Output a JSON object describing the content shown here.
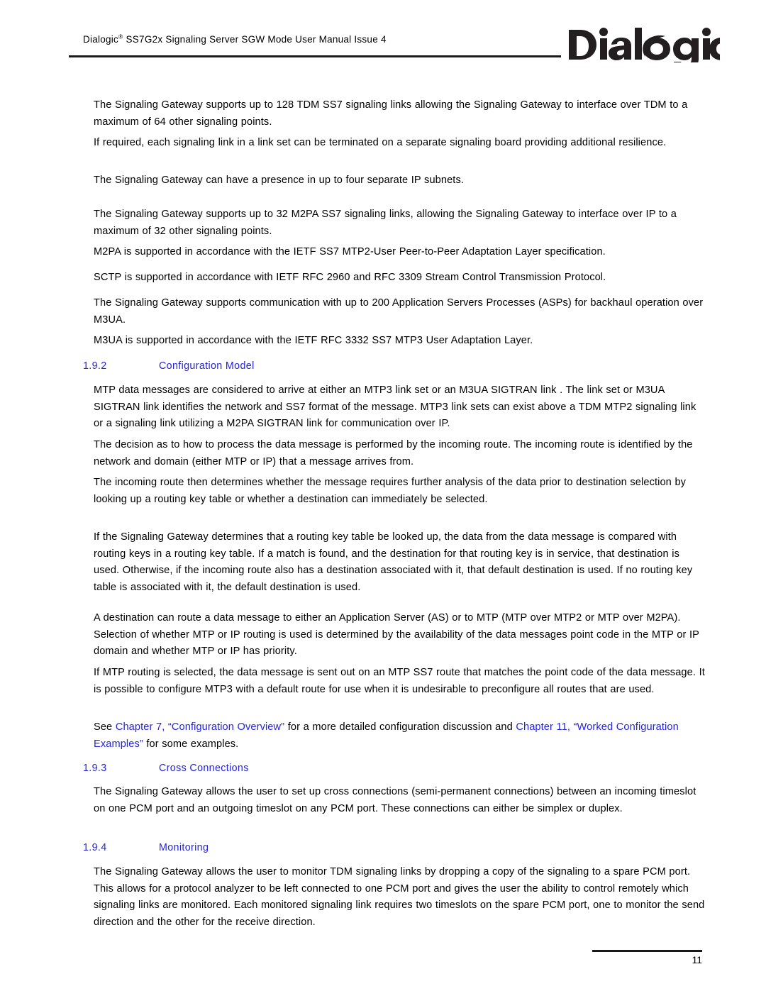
{
  "document": {
    "header_title_prefix": "Dialogic",
    "header_title_mark": "®",
    "header_title_rest": " SS7G2x Signaling Server SGW Mode User Manual  Issue 4",
    "logo_text": "Dialogic",
    "logo_mark": "®",
    "page_number": "11",
    "accent_blue": "#2323E0",
    "rule_color": "#1a1a1a"
  },
  "body": {
    "p1": "The Signaling Gateway supports up to 128 TDM SS7 signaling links allowing the Signaling Gateway to interface over TDM to a maximum of 64 other signaling points.",
    "p2": "If required, each signaling link in a link set can be terminated on a separate signaling board providing additional resilience.",
    "p3": "The Signaling Gateway can have a presence in up to four separate IP subnets.",
    "p4": "The Signaling Gateway supports up to 32 M2PA SS7 signaling links, allowing the Signaling Gateway to interface over IP to a maximum of 32 other signaling points.",
    "p5": "M2PA is supported in accordance with the IETF SS7 MTP2-User Peer-to-Peer Adaptation Layer specification.",
    "p6": "SCTP is supported in accordance with IETF RFC 2960 and RFC 3309 Stream Control Transmission Protocol.",
    "p7": "The Signaling Gateway supports communication with up to 200 Application Servers Processes (ASPs) for backhaul operation over M3UA.",
    "p8": "M3UA is supported in accordance with the IETF RFC 3332 SS7 MTP3 User Adaptation Layer.",
    "p9": "MTP data messages are considered to arrive at either an MTP3 link set  or an M3UA SIGTRAN link  . The link set or M3UA SIGTRAN link identifies the network and SS7 format of the message. MTP3 link sets can exist above a TDM MTP2 signaling link or a signaling link utilizing a M2PA SIGTRAN link for communication over IP.",
    "p10": "The decision as to how to process the data message is performed by the incoming route. The incoming route  is identified by the network and domain (either MTP or IP) that a message arrives from.",
    "p11": "The incoming route then determines whether the message requires further analysis of the data prior to destination selection by looking up a routing key  table or whether a destination  can immediately be selected.",
    "p12": "If the Signaling Gateway determines that a routing key table be looked up, the data from the data message is compared with routing keys in a routing key table. If a match is found, and the destination for that routing key is in service, that destination is used. Otherwise, if the incoming route also has a destination associated with it, that default destination is used. If no routing key table is associated with it, the default destination is used.",
    "p13": "A destination can route a data message to either an Application Server   (AS) or to MTP (MTP over MTP2 or MTP over M2PA). Selection of whether MTP or IP routing is used is determined by the availability of the data messages point code in the MTP or IP domain and whether MTP or IP has priority.",
    "p14": "If MTP routing is selected, the data message is sent out on an MTP SS7 route  that matches the point code of the data message. It is possible to configure MTP3 with a default route for use when it is undesirable to preconfigure all routes that are used.",
    "p15_part1": "See ",
    "p15_link1": "Chapter 7, “Configuration Overview”",
    "p15_part2": " for a more detailed configuration discussion and ",
    "p15_link2": "Chapter 11, “Worked Configuration Examples”",
    "p15_part3": " for some examples.",
    "p16": "The Signaling Gateway allows the user to set up cross connections (semi-permanent connections) between an incoming timeslot on one PCM port and an outgoing timeslot on any PCM port. These connections can either be simplex or duplex.",
    "p17": "The Signaling Gateway allows the user to monitor TDM signaling links by dropping a copy of the signaling to a spare PCM port. This allows for a protocol analyzer to be left connected to one PCM port and gives the user the ability to control remotely which signaling links are monitored. Each monitored signaling link requires two timeslots on the spare PCM port, one to monitor the send direction and the other for the receive direction."
  },
  "headings": {
    "h192_num": "1.9.2",
    "h192_title": "Configuration Model",
    "h193_num": "1.9.3",
    "h193_title": "Cross Connections",
    "h194_num": "1.9.4",
    "h194_title": "Monitoring"
  }
}
